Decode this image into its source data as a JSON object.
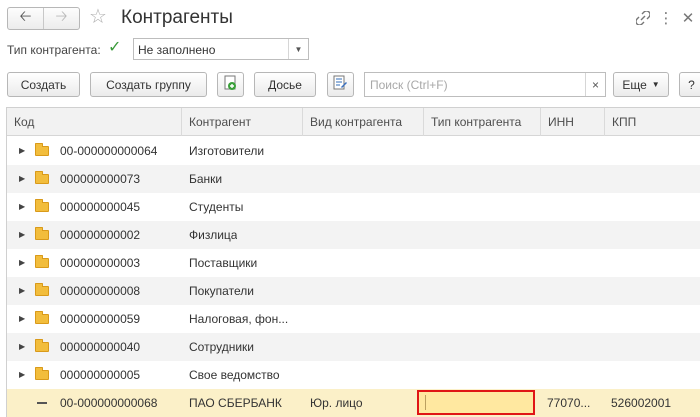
{
  "header": {
    "title": "Контрагенты",
    "back_icon": "arrow-left-icon",
    "forward_icon": "arrow-right-icon",
    "favorite_icon": "star-icon",
    "link_icon": "link-icon",
    "menu_icon": "more-vertical-icon",
    "close_icon": "close-icon"
  },
  "filter": {
    "label": "Тип контрагента:",
    "checked": true,
    "value": "Не заполнено"
  },
  "toolbar": {
    "create_label": "Создать",
    "create_group_label": "Создать группу",
    "dossier_label": "Досье",
    "search_placeholder": "Поиск (Ctrl+F)",
    "clear_label": "×",
    "more_label": "Еще",
    "help_label": "?"
  },
  "table": {
    "columns": [
      "Код",
      "Контрагент",
      "Вид контрагента",
      "Тип контрагента",
      "ИНН",
      "КПП"
    ],
    "rows": [
      {
        "code": "00-000000000064",
        "name": "Изготовители",
        "kind": "",
        "type": "",
        "inn": "",
        "kpp": "",
        "group": true
      },
      {
        "code": "000000000073",
        "name": "Банки",
        "kind": "",
        "type": "",
        "inn": "",
        "kpp": "",
        "group": true
      },
      {
        "code": "000000000045",
        "name": "Студенты",
        "kind": "",
        "type": "",
        "inn": "",
        "kpp": "",
        "group": true
      },
      {
        "code": "000000000002",
        "name": "Физлица",
        "kind": "",
        "type": "",
        "inn": "",
        "kpp": "",
        "group": true
      },
      {
        "code": "000000000003",
        "name": "Поставщики",
        "kind": "",
        "type": "",
        "inn": "",
        "kpp": "",
        "group": true
      },
      {
        "code": "000000000008",
        "name": "Покупатели",
        "kind": "",
        "type": "",
        "inn": "",
        "kpp": "",
        "group": true
      },
      {
        "code": "000000000059",
        "name": "Налоговая, фон...",
        "kind": "",
        "type": "",
        "inn": "",
        "kpp": "",
        "group": true
      },
      {
        "code": "000000000040",
        "name": "Сотрудники",
        "kind": "",
        "type": "",
        "inn": "",
        "kpp": "",
        "group": true
      },
      {
        "code": "000000000005",
        "name": "Свое ведомство",
        "kind": "",
        "type": "",
        "inn": "",
        "kpp": "",
        "group": true
      },
      {
        "code": "00-000000000068",
        "name": "ПАО СБЕРБАНК",
        "kind": "Юр. лицо",
        "type": "",
        "inn": "77070...",
        "kpp": "526002001",
        "group": false
      }
    ]
  },
  "colors": {
    "selected_row": "#fbf0c8",
    "edit_cell_border": "#e01515",
    "edit_cell_fill": "#ffe8a0",
    "checkbox": "#3a9a3a",
    "folder": "#f2bd3c"
  }
}
